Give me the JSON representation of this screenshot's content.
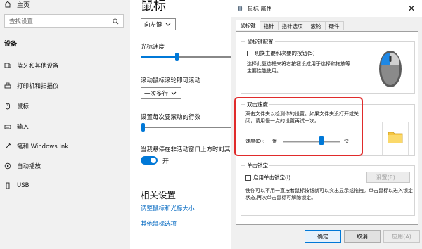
{
  "sidebar": {
    "home": "主页",
    "search_placeholder": "查找设置",
    "section": "设备",
    "items": [
      {
        "label": "蓝牙和其他设备",
        "icon": "bluetooth-icon"
      },
      {
        "label": "打印机和扫描仪",
        "icon": "printer-icon"
      },
      {
        "label": "鼠标",
        "icon": "mouse-icon"
      },
      {
        "label": "输入",
        "icon": "keyboard-icon"
      },
      {
        "label": "笔和 Windows Ink",
        "icon": "pen-icon"
      },
      {
        "label": "自动播放",
        "icon": "autoplay-icon"
      },
      {
        "label": "USB",
        "icon": "usb-icon"
      }
    ]
  },
  "main": {
    "title": "鼠标",
    "primary_button_value": "向左键",
    "cursor_speed_label": "光标速度",
    "cursor_speed_value": 0.4,
    "scroll_label": "滚动鼠标滚轮即可滚动",
    "scroll_value": "一次多行",
    "lines_label": "设置每次要滚动的行数",
    "lines_value": 0.02,
    "hover_label": "当我悬停在非活动窗口上方时对其",
    "toggle_state": "开",
    "related_title": "相关设置",
    "link1": "调整鼠标和光标大小",
    "link2": "其他鼠标选项"
  },
  "dialog": {
    "title": "鼠标 属性",
    "tabs": [
      "鼠标键",
      "指针",
      "指针选项",
      "滚轮",
      "硬件"
    ],
    "button_config_title": "鼠标键配置",
    "swap_buttons_label": "切换主要和次要的按钮(S)",
    "swap_description": "选择此复选框来将右按钮设成用于选择和拖放等主要性能使用。",
    "double_click_title": "双击速度",
    "double_click_description": "双击文件夹以检测你的设置。如果文件夹没打开或关闭，请用慢一点的设置再试一次。",
    "speed_label": "速度(D):",
    "slow_label": "慢",
    "fast_label": "快",
    "speed_value": 0.68,
    "clicklock_title": "单击锁定",
    "clicklock_label": "启用单击锁定(I)",
    "clicklock_settings": "设置(E)...",
    "clicklock_description": "使你可以不用一直按着鼠标按钮就可以突出显示或拖拽。单击鼠标以进入锁定状态,再次单击鼠标可解除锁定。",
    "ok": "确定",
    "cancel": "取消",
    "apply": "应用(A)",
    "accent": "#0078d7",
    "highlight_color": "#e02b2b"
  }
}
